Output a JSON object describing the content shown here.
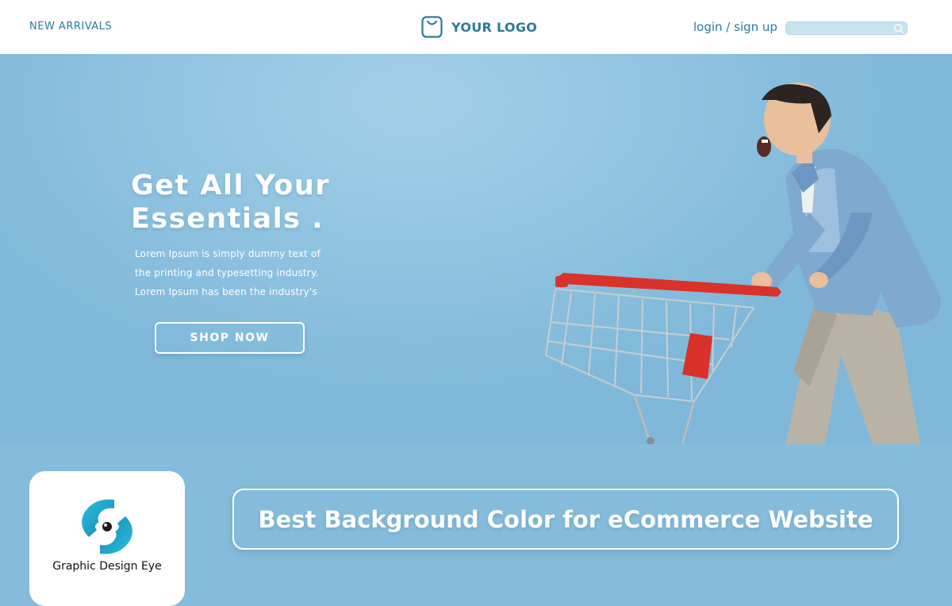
{
  "header": {
    "nav_new_arrivals": "NEW ARRIVALS",
    "logo_text": "YOUR LOGO",
    "login_signup": "login / sign up",
    "search_value": "",
    "icons": {
      "logo": "shopping-bag-icon",
      "search": "search-icon"
    }
  },
  "hero": {
    "title_line1": "Get All Your",
    "title_line2": "Essentials .",
    "body_line1": "Lorem Ipsum is simply dummy text of",
    "body_line2": "the printing and typesetting industry.",
    "body_line3": "Lorem Ipsum has been the industry's",
    "cta_label": "SHOP NOW",
    "image": "man-pushing-shopping-cart-photo"
  },
  "footer": {
    "brand_name": "Graphic Design Eye",
    "brand_icon": "eye-swirl-logo-icon",
    "headline": "Best Background Color for eCommerce Website"
  },
  "colors": {
    "accent": "#2b7a9e",
    "hero_background": "#8fc3e0",
    "page_background": "#85bcdb",
    "cart_red": "#d9322b",
    "white": "#ffffff"
  }
}
